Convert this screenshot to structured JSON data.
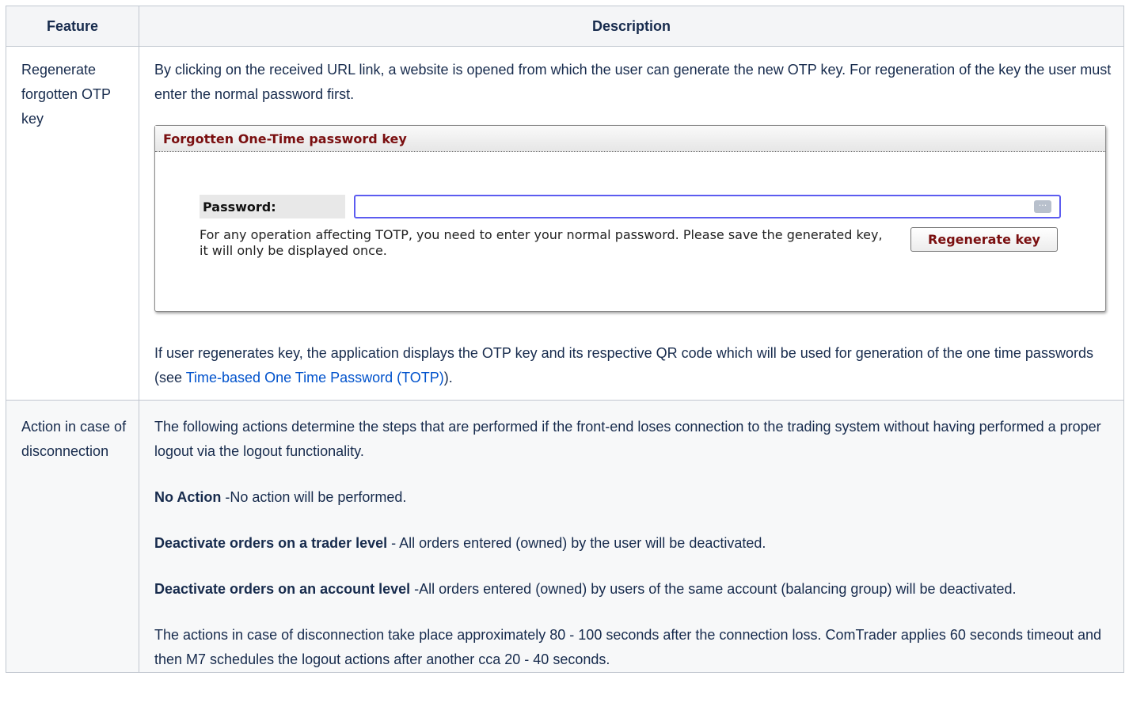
{
  "table": {
    "headers": {
      "feature": "Feature",
      "description": "Description"
    },
    "rows": [
      {
        "feature": "Regenerate forgotten OTP key",
        "intro": "By clicking on the received URL link, a website is opened from which the user can generate the new OTP key. For regeneration of the key the user must enter the normal password first.",
        "form": {
          "title": "Forgotten One-Time password key",
          "password_label": "Password:",
          "password_value": "",
          "password_icon": "ellipsis-icon",
          "help_text": "For any operation affecting TOTP, you need to enter your normal password. Please save the generated key, it will only be displayed once.",
          "button_label": "Regenerate key"
        },
        "outro_before_link": "If user regenerates key, the application displays the OTP key and its respective QR code which will be used for generation of the one time passwords (see ",
        "link_text": "Time-based One Time Password (TOTP)",
        "outro_after_link": ")."
      },
      {
        "feature": "Action in case of disconnection",
        "intro": "The following actions determine the steps that are performed if the front-end loses connection to the trading system without having performed a proper logout via the logout functionality.",
        "options": [
          {
            "name": "No Action",
            "text": " -No action will be performed."
          },
          {
            "name": "Deactivate orders on a trader level",
            "text": " - All orders entered (owned) by the user will be deactivated."
          },
          {
            "name": "Deactivate orders on an account level",
            "text": " -All orders entered (owned) by users of the same account (balancing group) will be deactivated."
          }
        ],
        "note": "The actions in case of disconnection take place approximately 80 - 100 seconds after the connection loss. ComTrader applies 60 seconds timeout and then M7 schedules the logout actions after another cca 20 - 40 seconds."
      }
    ]
  },
  "colors": {
    "header_bg": "#f4f5f7",
    "border": "#c1c7d0",
    "link": "#0052cc",
    "form_title": "#7a0f10",
    "input_focus": "#5c5cf0"
  }
}
